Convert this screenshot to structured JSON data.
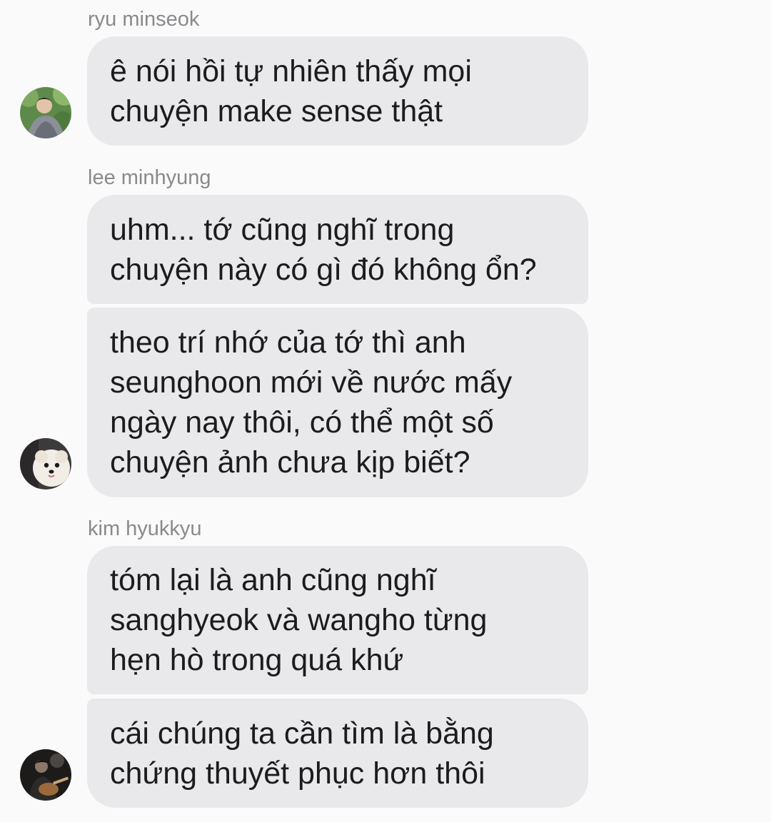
{
  "messages": [
    {
      "sender": "ryu minseok",
      "avatar_icon": "avatar-person-greenery-icon",
      "bubbles": [
        {
          "lines": [
            "ê nói hồi tự nhiên thấy mọi",
            "chuyện make sense thật"
          ]
        }
      ]
    },
    {
      "sender": "lee minhyung",
      "avatar_icon": "avatar-pomeranian-dog-icon",
      "bubbles": [
        {
          "lines": [
            "uhm... tớ cũng nghĩ trong",
            "chuyện này có gì đó không ổn?"
          ]
        },
        {
          "lines": [
            "theo trí nhớ của tớ thì anh",
            "seunghoon mới về nước mấy",
            "ngày nay thôi, có thể một số",
            "chuyện ảnh chưa kịp biết?"
          ]
        }
      ]
    },
    {
      "sender": "kim hyukkyu",
      "avatar_icon": "avatar-guitar-player-icon",
      "bubbles": [
        {
          "lines": [
            "tóm lại là anh cũng nghĩ",
            "sanghyeok và wangho từng",
            "hẹn hò trong quá khứ"
          ]
        },
        {
          "lines": [
            "cái chúng ta cần tìm là bằng",
            "chứng thuyết phục hơn thôi"
          ]
        }
      ]
    }
  ],
  "colors": {
    "background": "#fafafa",
    "bubble": "#e9e9eb",
    "text": "#1c1c1e",
    "sender_name": "#8a8a8e"
  }
}
